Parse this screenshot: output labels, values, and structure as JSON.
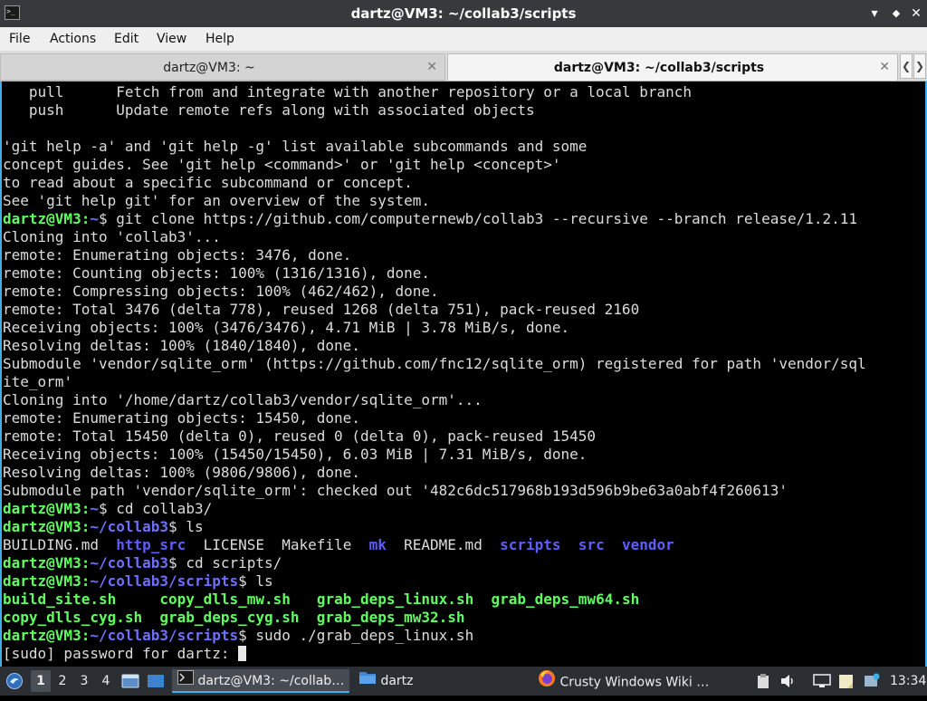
{
  "window": {
    "title": "dartz@VM3: ~/collab3/scripts",
    "app_icon_glyph": ">_",
    "controls": {
      "minimize": "▾",
      "maximize": "◆",
      "close": "✕"
    }
  },
  "menu": [
    "File",
    "Actions",
    "Edit",
    "View",
    "Help"
  ],
  "tabs": [
    {
      "label": "dartz@VM3: ~",
      "active": false
    },
    {
      "label": "dartz@VM3: ~/collab3/scripts",
      "active": true
    }
  ],
  "tab_close_glyph": "✕",
  "tab_nav": {
    "left": "❮",
    "right": "❯"
  },
  "terminal": {
    "prompt_user": "dartz@VM3",
    "lines": [
      {
        "text": "   pull      Fetch from and integrate with another repository or a local branch"
      },
      {
        "text": "   push      Update remote refs along with associated objects"
      },
      {
        "text": ""
      },
      {
        "text": "'git help -a' and 'git help -g' list available subcommands and some"
      },
      {
        "text": "concept guides. See 'git help <command>' or 'git help <concept>'"
      },
      {
        "text": "to read about a specific subcommand or concept."
      },
      {
        "text": "See 'git help git' for an overview of the system."
      },
      {
        "prompt": "dartz@VM3",
        "path": "~",
        "cmd": "git clone https://github.com/computernewb/collab3 --recursive --branch release/1.2.11"
      },
      {
        "text": "Cloning into 'collab3'..."
      },
      {
        "text": "remote: Enumerating objects: 3476, done."
      },
      {
        "text": "remote: Counting objects: 100% (1316/1316), done."
      },
      {
        "text": "remote: Compressing objects: 100% (462/462), done."
      },
      {
        "text": "remote: Total 3476 (delta 778), reused 1268 (delta 751), pack-reused 2160"
      },
      {
        "text": "Receiving objects: 100% (3476/3476), 4.71 MiB | 3.78 MiB/s, done."
      },
      {
        "text": "Resolving deltas: 100% (1840/1840), done."
      },
      {
        "text": "Submodule 'vendor/sqlite_orm' (https://github.com/fnc12/sqlite_orm) registered for path 'vendor/sql"
      },
      {
        "text": "ite_orm'"
      },
      {
        "text": "Cloning into '/home/dartz/collab3/vendor/sqlite_orm'..."
      },
      {
        "text": "remote: Enumerating objects: 15450, done."
      },
      {
        "text": "remote: Total 15450 (delta 0), reused 0 (delta 0), pack-reused 15450"
      },
      {
        "text": "Receiving objects: 100% (15450/15450), 6.03 MiB | 7.31 MiB/s, done."
      },
      {
        "text": "Resolving deltas: 100% (9806/9806), done."
      },
      {
        "text": "Submodule path 'vendor/sqlite_orm': checked out '482c6dc517968b193d596b9be63a0abf4f260613'"
      },
      {
        "prompt": "dartz@VM3",
        "path": "~",
        "cmd": "cd collab3/"
      },
      {
        "prompt": "dartz@VM3",
        "path": "~/collab3",
        "cmd": "ls"
      },
      {
        "ls": [
          {
            "name": "BUILDING.md",
            "kind": "file"
          },
          {
            "sep": "  "
          },
          {
            "name": "http_src",
            "kind": "dir"
          },
          {
            "sep": "  "
          },
          {
            "name": "LICENSE",
            "kind": "file"
          },
          {
            "sep": "  "
          },
          {
            "name": "Makefile",
            "kind": "file"
          },
          {
            "sep": "  "
          },
          {
            "name": "mk",
            "kind": "dir"
          },
          {
            "sep": "  "
          },
          {
            "name": "README.md",
            "kind": "file"
          },
          {
            "sep": "  "
          },
          {
            "name": "scripts",
            "kind": "dir"
          },
          {
            "sep": "  "
          },
          {
            "name": "src",
            "kind": "dir"
          },
          {
            "sep": "  "
          },
          {
            "name": "vendor",
            "kind": "dir"
          }
        ]
      },
      {
        "prompt": "dartz@VM3",
        "path": "~/collab3",
        "cmd": "cd scripts/"
      },
      {
        "prompt": "dartz@VM3",
        "path": "~/collab3/scripts",
        "cmd": "ls"
      },
      {
        "ls": [
          {
            "name": "build_site.sh",
            "kind": "exe"
          },
          {
            "sep": "     "
          },
          {
            "name": "copy_dlls_mw.sh",
            "kind": "exe"
          },
          {
            "sep": "   "
          },
          {
            "name": "grab_deps_linux.sh",
            "kind": "exe"
          },
          {
            "sep": "  "
          },
          {
            "name": "grab_deps_mw64.sh",
            "kind": "exe"
          }
        ]
      },
      {
        "ls": [
          {
            "name": "copy_dlls_cyg.sh",
            "kind": "exe"
          },
          {
            "sep": "  "
          },
          {
            "name": "grab_deps_cyg.sh",
            "kind": "exe"
          },
          {
            "sep": "  "
          },
          {
            "name": "grab_deps_mw32.sh",
            "kind": "exe"
          }
        ]
      },
      {
        "prompt": "dartz@VM3",
        "path": "~/collab3/scripts",
        "cmd": "sudo ./grab_deps_linux.sh"
      },
      {
        "text": "[sudo] password for dartz: ",
        "cursor": true
      }
    ]
  },
  "taskbar": {
    "workspaces": [
      "1",
      "2",
      "3",
      "4"
    ],
    "active_workspace": "1",
    "tasks": [
      {
        "label": "dartz@VM3: ~/collab…",
        "icon": "terminal-icon",
        "active": true
      },
      {
        "label": "dartz",
        "icon": "folder-icon",
        "active": false
      },
      {
        "label": "Crusty Windows Wiki …",
        "icon": "firefox-icon",
        "active": false
      }
    ],
    "clock": "13:34"
  },
  "colors": {
    "prompt_user": "#5fff5f",
    "prompt_path": "#6f6fff",
    "directory": "#5e5eff",
    "executable": "#5fff5f",
    "accent": "#3daee9"
  }
}
